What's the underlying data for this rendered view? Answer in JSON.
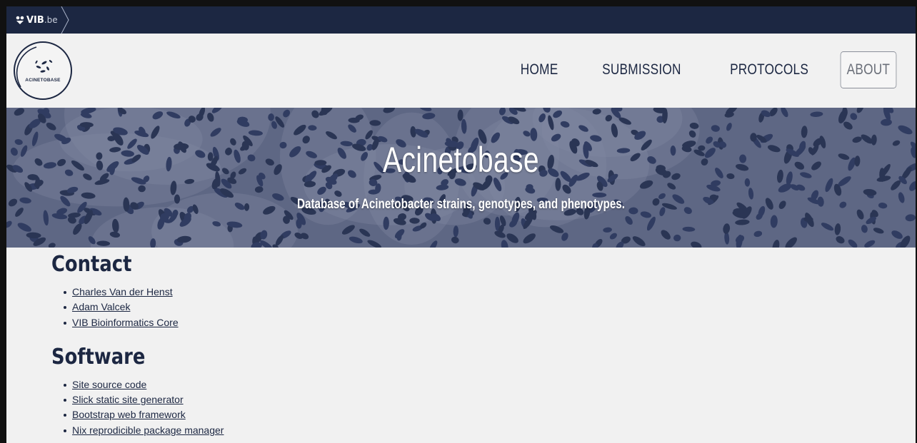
{
  "vib_bar": {
    "brand": "VIB",
    "domain": ".be"
  },
  "header": {
    "logo_text": "ACINETOBASE",
    "nav": [
      {
        "label": "HOME",
        "active": false
      },
      {
        "label": "SUBMISSION",
        "active": false
      },
      {
        "label": "PROTOCOLS",
        "active": false
      },
      {
        "label": "ABOUT",
        "active": true
      }
    ]
  },
  "hero": {
    "title": "Acinetobase",
    "subtitle": "Database of Acinetobacter strains, genotypes, and phenotypes."
  },
  "contact": {
    "title": "Contact",
    "links": [
      "Charles Van der Henst",
      "Adam Valcek",
      "VIB Bioinformatics Core"
    ]
  },
  "software": {
    "title": "Software",
    "links": [
      "Site source code",
      "Slick static site generator",
      "Bootstrap web framework",
      "Nix reprodicible package manager"
    ]
  },
  "colors": {
    "navy": "#1c2742",
    "page_bg": "#f1f1f1",
    "hero_tint": "#5f6784"
  }
}
